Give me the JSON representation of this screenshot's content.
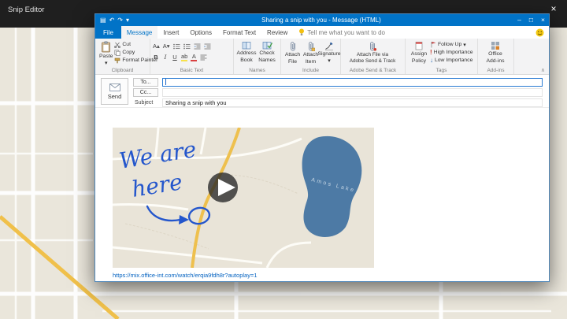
{
  "snip_editor": {
    "title": "Snip Editor",
    "close_glyph": "×"
  },
  "outlook": {
    "title": "Sharing a snip with you - Message (HTML)",
    "window_controls": {
      "minimize": "–",
      "maximize": "□",
      "close": "×"
    },
    "qat": {
      "save": "▤",
      "undo": "↶",
      "redo": "↷",
      "more": "▾"
    },
    "tabs": [
      "File",
      "Message",
      "Insert",
      "Options",
      "Format Text",
      "Review"
    ],
    "tell_me": "Tell me what you want to do",
    "glyphs": {
      "dropdown": "▾",
      "collapse": "∧",
      "high": "!",
      "low": "↓"
    },
    "ribbon": {
      "clipboard": {
        "group": "Clipboard",
        "paste": "Paste",
        "cut": "Cut",
        "copy": "Copy",
        "format_painter": "Format Painter"
      },
      "basic_text": {
        "group": "Basic Text",
        "grow": "A▴",
        "shrink": "A▾",
        "bold": "B",
        "italic": "I",
        "underline": "U",
        "highlight": "ab",
        "font_color": "A"
      },
      "names": {
        "group": "Names",
        "address_book_l1": "Address",
        "address_book_l2": "Book",
        "check_names_l1": "Check",
        "check_names_l2": "Names"
      },
      "include": {
        "group": "Include",
        "attach_file_l1": "Attach",
        "attach_file_l2": "File",
        "attach_item_l1": "Attach",
        "attach_item_l2": "Item",
        "signature": "Signature"
      },
      "adobe": {
        "group": "Adobe Send & Track",
        "button_l1": "Attach File via",
        "button_l2": "Adobe Send & Track"
      },
      "tags": {
        "group": "Tags",
        "assign_l1": "Assign",
        "assign_l2": "Policy",
        "follow_up": "Follow Up",
        "high_importance": "High Importance",
        "low_importance": "Low Importance"
      },
      "addins": {
        "group": "Add-ins",
        "button_l1": "Office",
        "button_l2": "Add-ins"
      }
    },
    "compose": {
      "send": "Send",
      "to": "To...",
      "cc": "Cc...",
      "subject_label": "Subject",
      "subject_value": "Sharing a snip with you",
      "link": "https://mix.office-int.com/watch/erqia9fdh8r?autoplay=1"
    },
    "snip": {
      "ink_line1": "We are",
      "ink_line2": "here",
      "lake_label": "Amos Lake"
    }
  },
  "colors": {
    "outlook_blue": "#0173C7",
    "ink_blue": "#2456cc",
    "lake_blue": "#4d7aa5",
    "link_blue": "#0563C1",
    "map_beige": "#eae6db"
  }
}
